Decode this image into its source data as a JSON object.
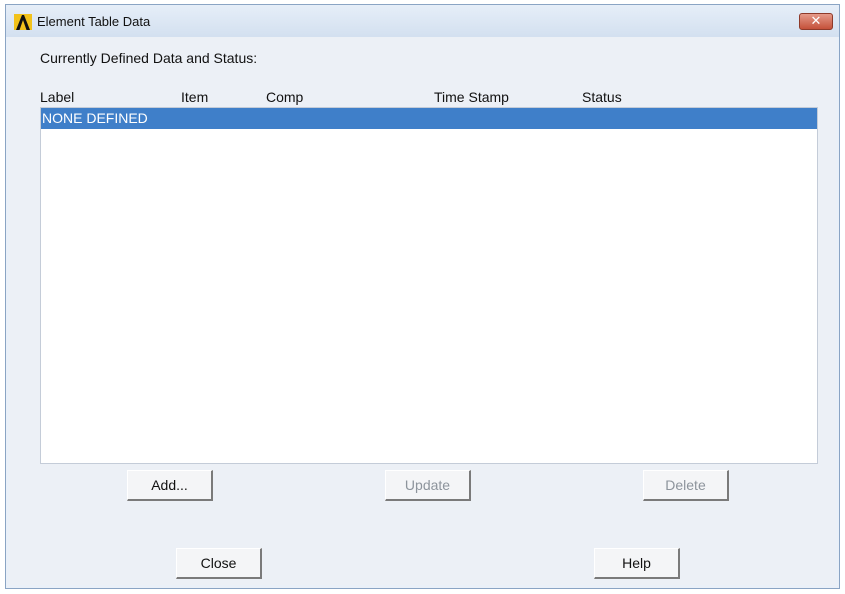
{
  "window": {
    "title": "Element Table Data"
  },
  "heading": "Currently Defined Data and Status:",
  "columns": [
    "Label",
    "Item",
    "Comp",
    "Time Stamp",
    "Status"
  ],
  "rows": [
    {
      "label": "NONE DEFINED",
      "selected": true
    }
  ],
  "buttons": {
    "add": "Add...",
    "update": "Update",
    "delete": "Delete",
    "close": "Close",
    "help": "Help"
  },
  "colors": {
    "selection": "#3f7fc9",
    "close_button": "#c4513a"
  },
  "icons": {
    "app": "ansys-logo-icon",
    "window_close": "close-icon"
  }
}
